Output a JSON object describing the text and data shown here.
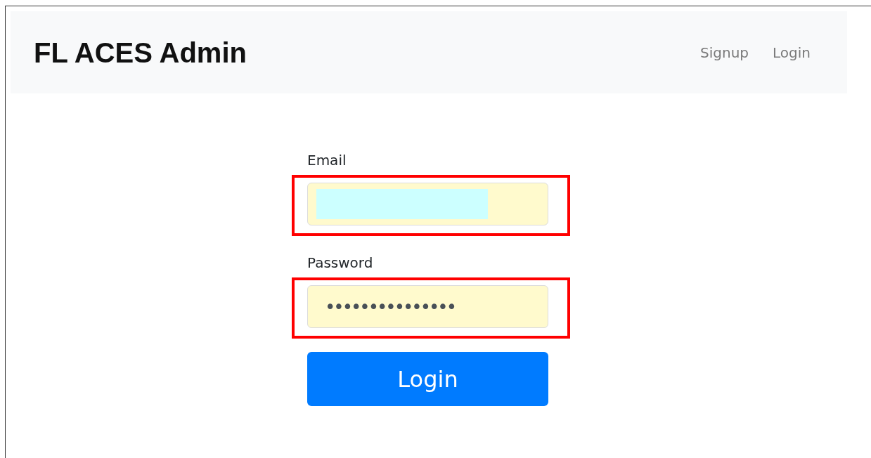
{
  "navbar": {
    "title": "FL ACES Admin",
    "links": [
      {
        "label": "Signup"
      },
      {
        "label": "Login"
      }
    ]
  },
  "form": {
    "fields": [
      {
        "kind": "email",
        "label": "Email",
        "redacted": true,
        "highlighted": true
      },
      {
        "kind": "password",
        "label": "Password",
        "value": "•••••••••••••••",
        "highlighted": true
      }
    ],
    "submit": "Login"
  }
}
